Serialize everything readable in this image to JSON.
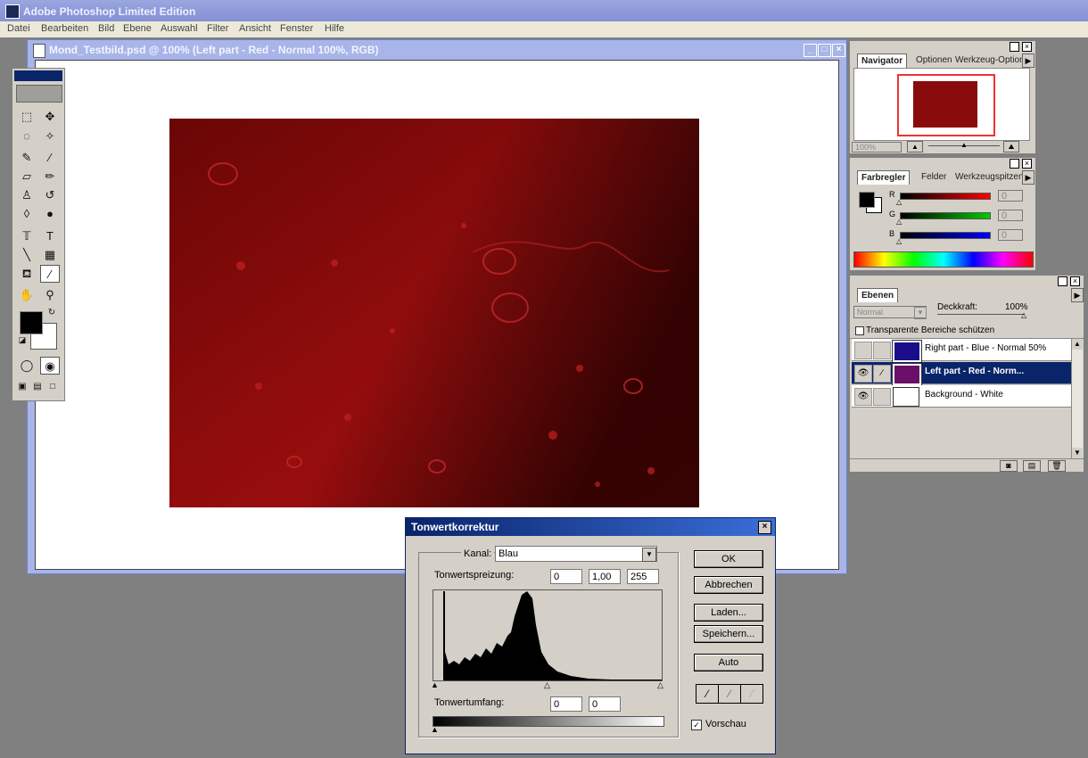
{
  "app": {
    "title": "Adobe Photoshop Limited Edition"
  },
  "menu": [
    "Datei",
    "Bearbeiten",
    "Bild",
    "Ebene",
    "Auswahl",
    "Filter",
    "Ansicht",
    "Fenster",
    "Hilfe"
  ],
  "document": {
    "title": "Mond_Testbild.psd @ 100%  (Left part - Red - Normal 100%, RGB)"
  },
  "navigator": {
    "tabs": [
      "Navigator",
      "Optionen",
      "Werkzeug-Optionen"
    ],
    "zoom": "100%"
  },
  "colors": {
    "tabs": [
      "Farbregler",
      "Felder",
      "Werkzeugspitzen"
    ],
    "channels": [
      {
        "label": "R",
        "value": "0"
      },
      {
        "label": "G",
        "value": "0"
      },
      {
        "label": "B",
        "value": "0"
      }
    ]
  },
  "layers": {
    "tab": "Ebenen",
    "blend_mode": "Normal",
    "opacity_label": "Deckkraft:",
    "opacity": "100%",
    "lock_label": "Transparente Bereiche schützen",
    "items": [
      {
        "name": "Right part - Blue - Normal 50%",
        "visible": false
      },
      {
        "name": "Left part - Red - Norm...",
        "visible": true
      },
      {
        "name": "Background - White",
        "visible": true
      }
    ]
  },
  "levels": {
    "title": "Tonwertkorrektur",
    "channel_label": "Kanal:",
    "channel": "Blau",
    "input_label": "Tonwertspreizung:",
    "input_black": "0",
    "input_gamma": "1,00",
    "input_white": "255",
    "output_label": "Tonwertumfang:",
    "output_black": "0",
    "output_white": "0",
    "ok": "OK",
    "cancel": "Abbrechen",
    "load": "Laden...",
    "save": "Speichern...",
    "auto": "Auto",
    "preview": "Vorschau",
    "preview_checked": true
  }
}
